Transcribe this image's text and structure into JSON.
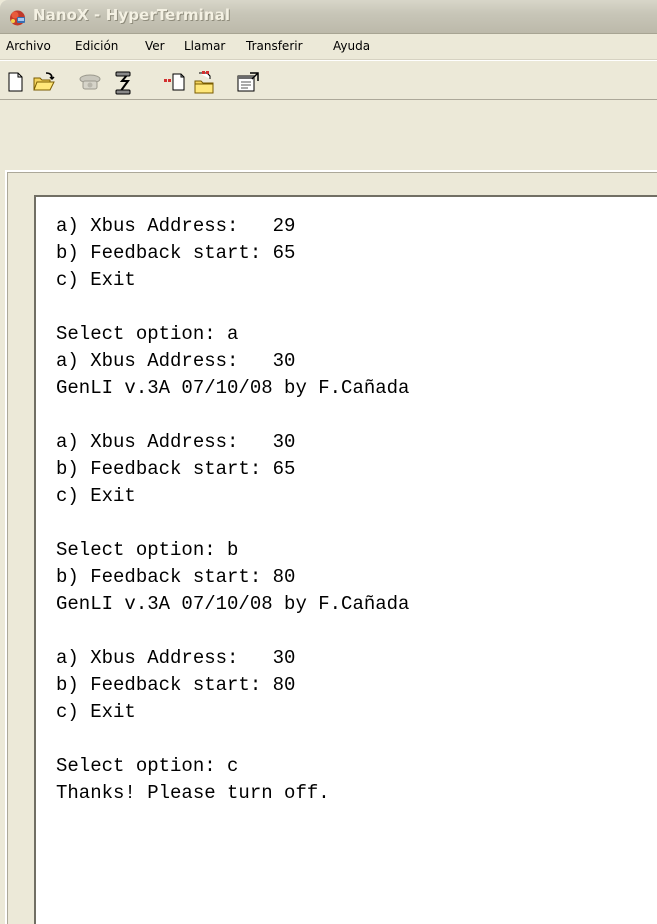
{
  "window": {
    "title": "NanoX - HyperTerminal"
  },
  "menu": [
    {
      "label": "Archivo"
    },
    {
      "label": "Edición"
    },
    {
      "label": "Ver"
    },
    {
      "label": "Llamar"
    },
    {
      "label": "Transferir"
    },
    {
      "label": "Ayuda"
    }
  ],
  "toolbar": {
    "buttons": [
      {
        "icon": "new-document-icon"
      },
      {
        "icon": "open-folder-icon"
      },
      {
        "icon": "phone-connect-icon"
      },
      {
        "icon": "disconnect-icon"
      },
      {
        "icon": "send-file-icon"
      },
      {
        "icon": "receive-file-icon"
      },
      {
        "icon": "properties-icon"
      }
    ]
  },
  "terminal": {
    "lines": [
      "a) Xbus Address:   29",
      "b) Feedback start: 65",
      "c) Exit",
      "",
      "Select option: a",
      "a) Xbus Address:   30",
      "GenLI v.3A 07/10/08 by F.Cañada",
      "",
      "a) Xbus Address:   30",
      "b) Feedback start: 65",
      "c) Exit",
      "",
      "Select option: b",
      "b) Feedback start: 80",
      "GenLI v.3A 07/10/08 by F.Cañada",
      "",
      "a) Xbus Address:   30",
      "b) Feedback start: 80",
      "c) Exit",
      "",
      "Select option: c",
      "Thanks! Please turn off."
    ]
  }
}
